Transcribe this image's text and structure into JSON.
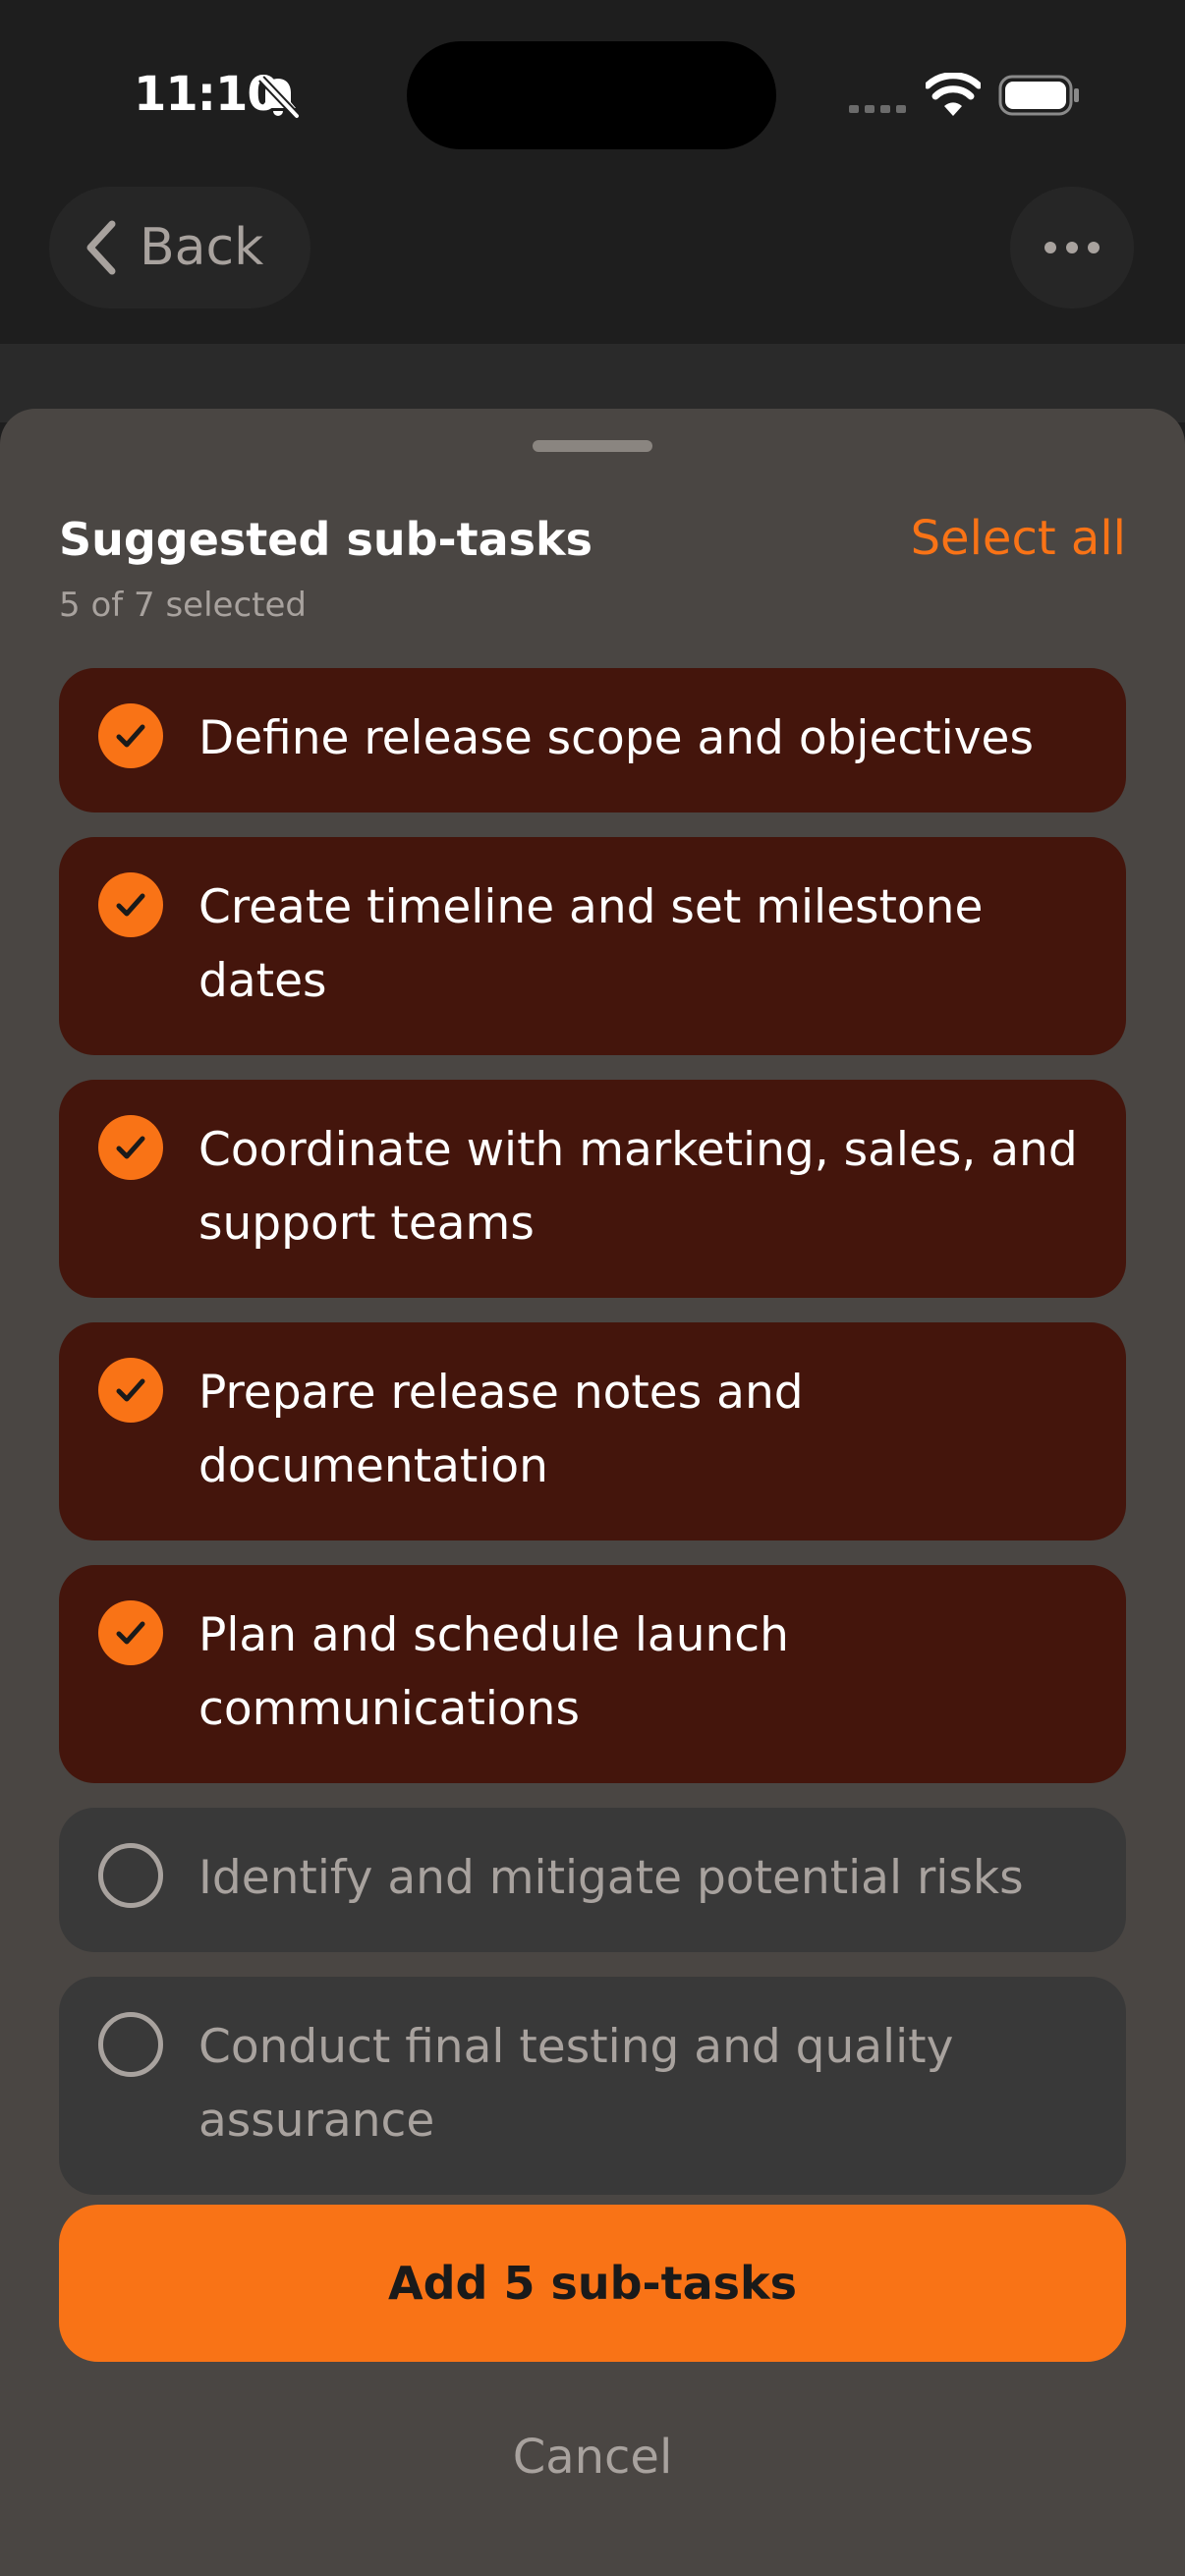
{
  "status_bar": {
    "time": "11:10",
    "icons": [
      "bell-off-icon",
      "signal-icon",
      "wifi-icon",
      "battery-icon"
    ]
  },
  "nav": {
    "back_label": "Back",
    "more_icon": "more-icon"
  },
  "sheet": {
    "title": "Suggested sub-tasks",
    "select_all_label": "Select all",
    "selection_count": "5 of 7 selected",
    "tasks": [
      {
        "label": "Define release scope and objectives",
        "selected": true
      },
      {
        "label": "Create timeline and set milestone dates",
        "selected": true
      },
      {
        "label": "Coordinate with marketing, sales, and support teams",
        "selected": true
      },
      {
        "label": "Prepare release notes and documentation",
        "selected": true
      },
      {
        "label": "Plan and schedule launch communications",
        "selected": true
      },
      {
        "label": "Identify and mitigate potential risks",
        "selected": false
      },
      {
        "label": "Conduct final testing and quality assurance",
        "selected": false
      }
    ],
    "add_button_label": "Add 5 sub-tasks",
    "cancel_label": "Cancel"
  },
  "colors": {
    "accent": "#f97316",
    "selected_bg": "#44150c",
    "unselected_bg": "#393939",
    "sheet_bg": "#4a4643"
  }
}
